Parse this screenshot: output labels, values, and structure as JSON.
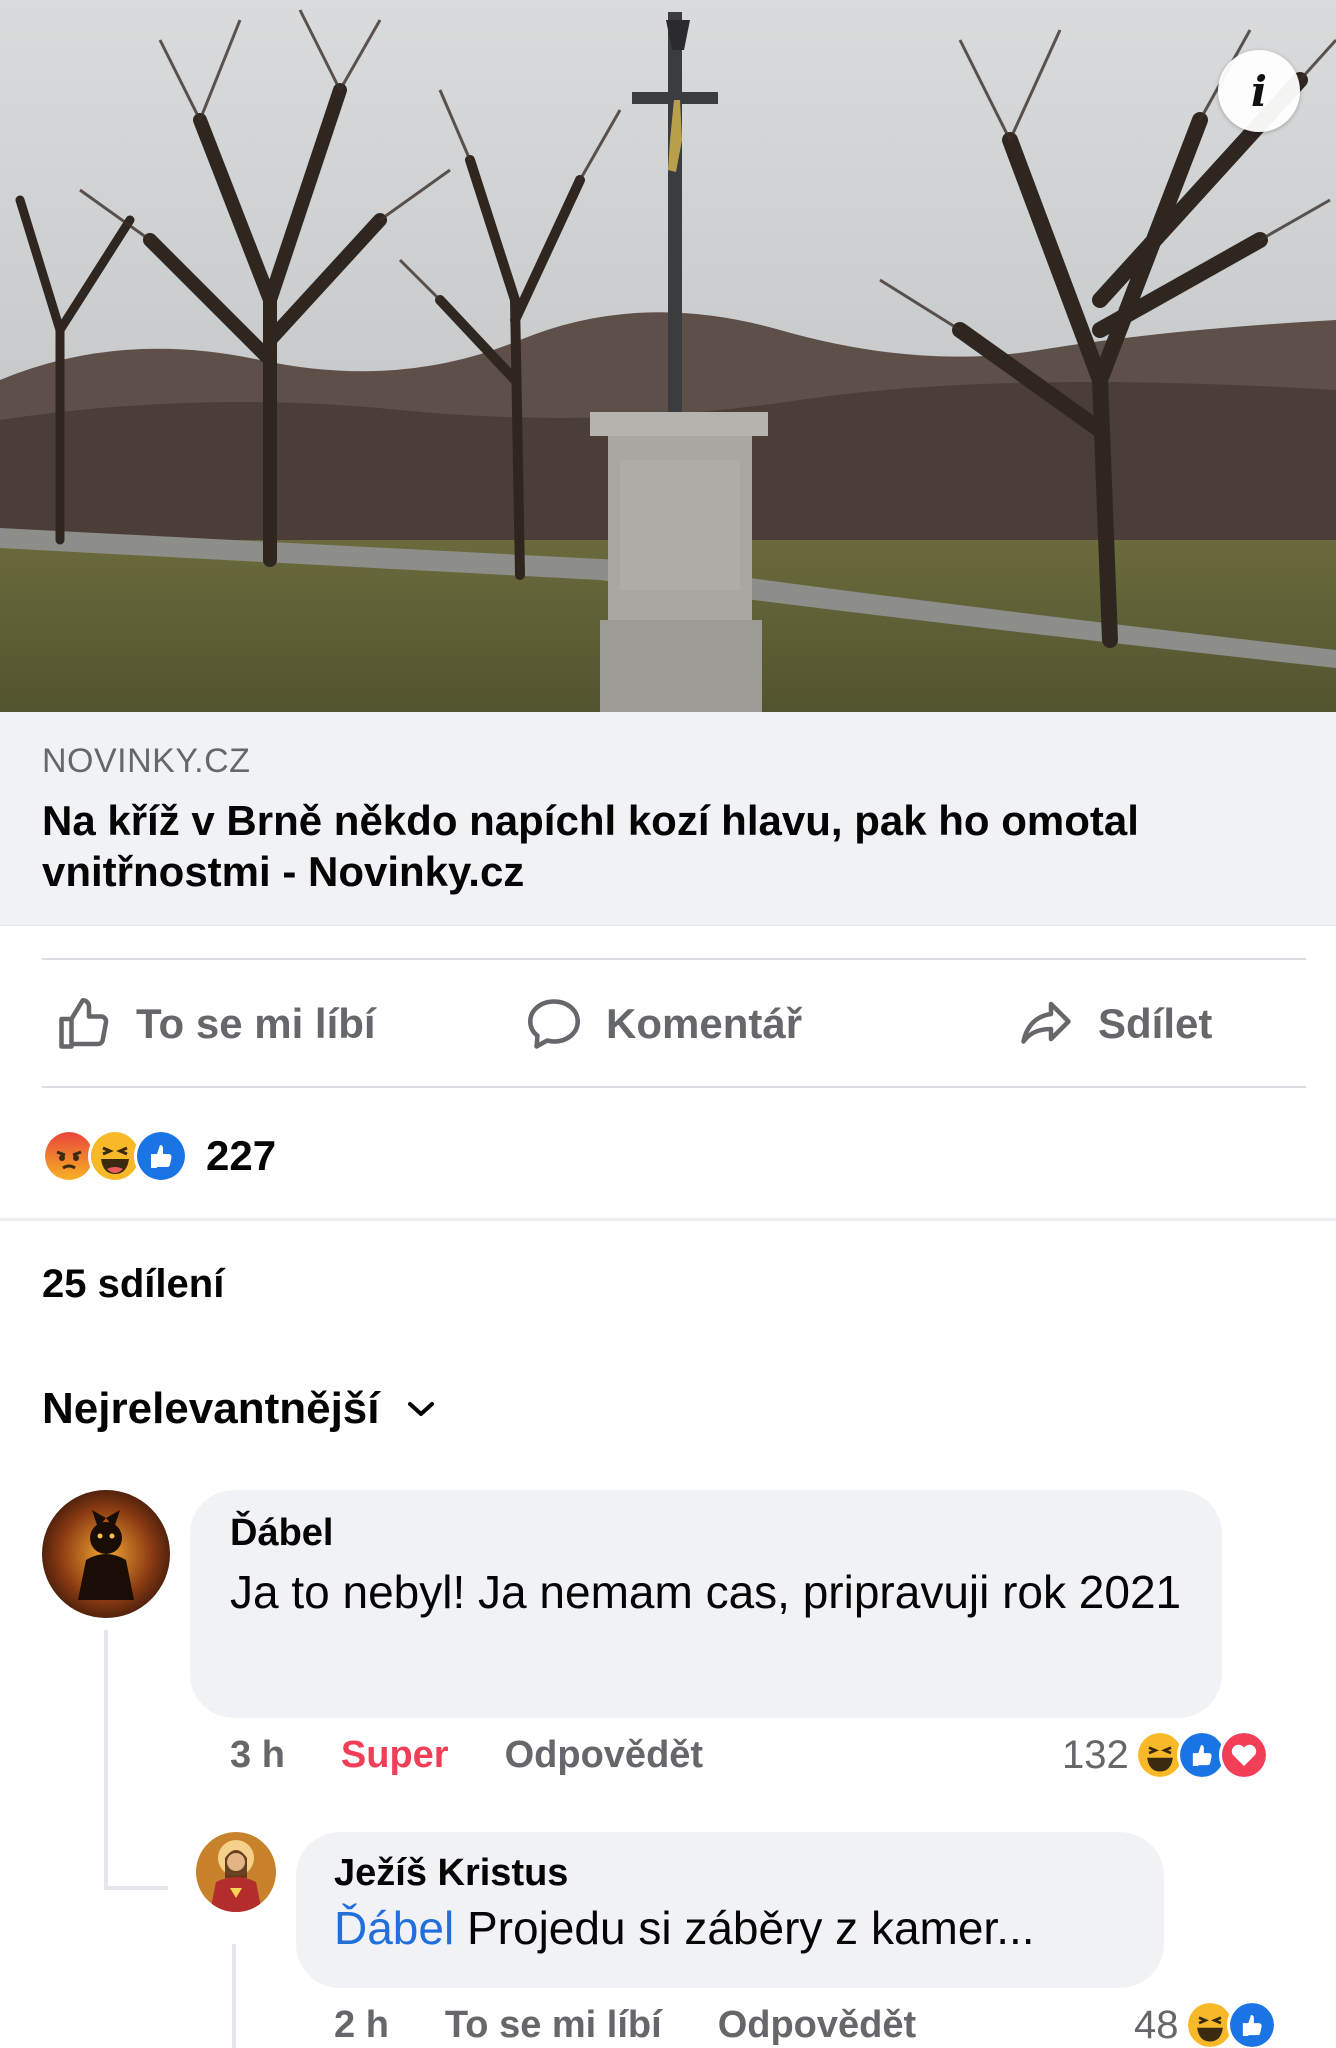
{
  "link": {
    "domain": "NOVINKY.CZ",
    "title": "Na kříž v Brně někdo napíchl kozí hlavu, pak ho omotal vnitřnostmi - Novinky.cz"
  },
  "actions": {
    "like_label": "To se mi líbí",
    "comment_label": "Komentář",
    "share_label": "Sdílet"
  },
  "reactions": {
    "icons": [
      "angry-icon",
      "haha-icon",
      "like-icon"
    ],
    "count": "227"
  },
  "shares_label": "25 sdílení",
  "sort_label": "Nejrelevantnější",
  "comments": [
    {
      "author": "Ďábel",
      "text": "Ja to nebyl! Ja nemam cas, pripravuji rok 2021",
      "time": "3 h",
      "reaction_label": "Super",
      "reply_label": "Odpovědět",
      "reaction_count": "132",
      "reaction_icons": [
        "haha-icon",
        "like-icon",
        "love-icon"
      ]
    },
    {
      "author": "Ježíš Kristus",
      "mention": "Ďábel",
      "text": "Projedu si záběry z kamer...",
      "time": "2 h",
      "like_label": "To se mi líbí",
      "reply_label": "Odpovědět",
      "reaction_count": "48",
      "reaction_icons": [
        "haha-icon",
        "like-icon"
      ]
    }
  ],
  "colors": {
    "link_bg": "#f0f2f5",
    "muted_text": "#65676b",
    "mention": "#216fdb",
    "super_reaction": "#f33e58"
  }
}
